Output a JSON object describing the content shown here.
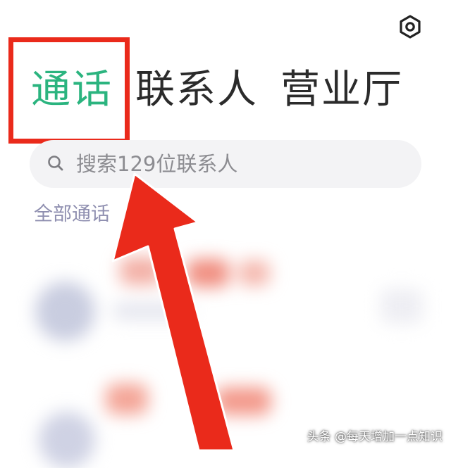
{
  "header": {
    "settings_icon": "hexagon-settings-icon"
  },
  "tabs": [
    {
      "label": "通话",
      "active": true
    },
    {
      "label": "联系人",
      "active": false
    },
    {
      "label": "营业厅",
      "active": false
    }
  ],
  "search": {
    "placeholder": "搜索129位联系人",
    "icon": "search-icon"
  },
  "filter": {
    "label": "全部通话"
  },
  "annotation": {
    "highlight_color": "#ea2a1b",
    "arrow_color": "#ea2a1b"
  },
  "watermark": {
    "text": "头条 @每天增加一点知识"
  },
  "colors": {
    "active_tab": "#2bb47f",
    "inactive_tab": "#2b2b2b",
    "search_bg": "#f3f3f5"
  }
}
